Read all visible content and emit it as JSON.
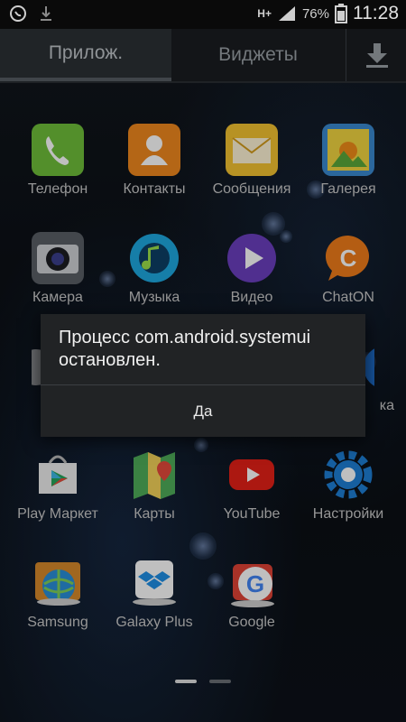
{
  "status_bar": {
    "network": "H+",
    "battery": "76%",
    "time": "11:28",
    "icons": [
      "whatsapp-icon",
      "download-icon",
      "network-hplus-icon",
      "signal-icon",
      "battery-icon"
    ]
  },
  "tabs": [
    {
      "label": "Прилож.",
      "selected": true
    },
    {
      "label": "Виджеты",
      "selected": false
    }
  ],
  "download_tab_icon": "download-icon",
  "apps": [
    {
      "label": "Телефон",
      "icon": "phone-icon",
      "color": "#6fbf3a"
    },
    {
      "label": "Контакты",
      "icon": "contacts-icon",
      "color": "#f0891e"
    },
    {
      "label": "Сообщения",
      "icon": "messages-icon",
      "color": "#f5c330"
    },
    {
      "label": "Галерея",
      "icon": "gallery-icon",
      "color": "#f2d640"
    },
    {
      "label": "Камера",
      "icon": "camera-icon",
      "color": "#5a5f66"
    },
    {
      "label": "Музыка",
      "icon": "music-icon",
      "color": "#1ea8e0"
    },
    {
      "label": "Видео",
      "icon": "video-icon",
      "color": "#6b3fbf"
    },
    {
      "label": "ChatON",
      "icon": "chaton-icon",
      "color": "#f07d1a"
    },
    {
      "label": "Play Маркет",
      "icon": "play-market-icon",
      "color": "#e8e8e8"
    },
    {
      "label": "Карты",
      "icon": "maps-icon",
      "color": "#4fae5a"
    },
    {
      "label": "YouTube",
      "icon": "youtube-icon",
      "color": "#e62117"
    },
    {
      "label": "Настройки",
      "icon": "settings-icon",
      "color": "#1e7fd6"
    },
    {
      "label": "Samsung",
      "icon": "samsung-folder-icon",
      "color": "#2a8fd8"
    },
    {
      "label": "Galaxy Plus",
      "icon": "galaxy-plus-icon",
      "color": "#1f8fe6"
    },
    {
      "label": "Google",
      "icon": "google-folder-icon",
      "color": "#ffffff"
    }
  ],
  "partial_labels": {
    "right": "ка"
  },
  "dialog": {
    "message": "Процесс com.android.systemui остановлен.",
    "ok_button": "Да"
  },
  "page_indicator": {
    "pages": 2,
    "current": 1
  }
}
